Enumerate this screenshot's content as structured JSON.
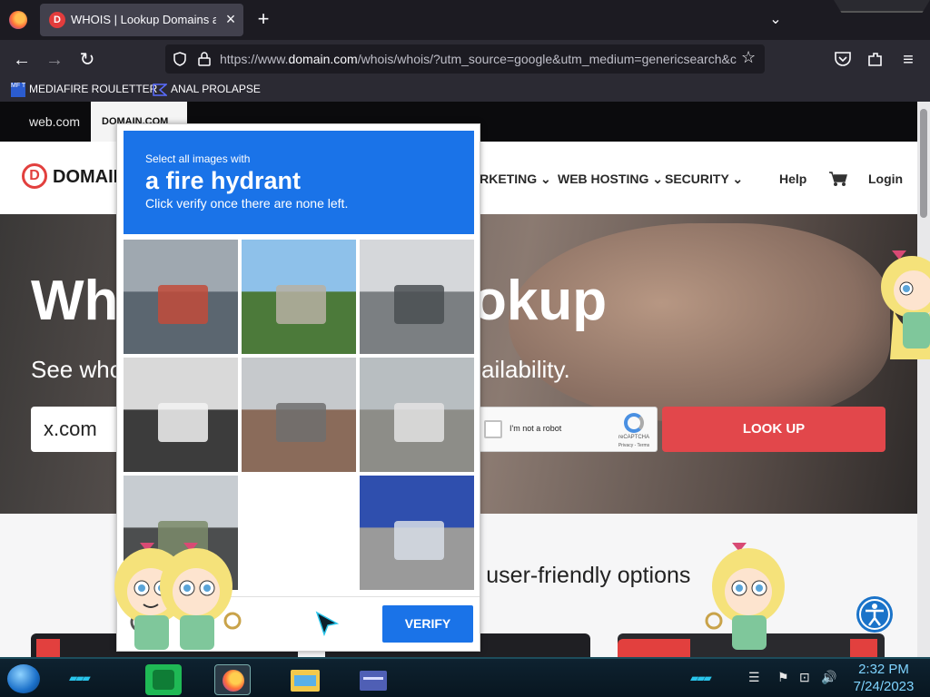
{
  "browser": {
    "tab_title": "WHOIS | Lookup Domains and",
    "tab_favicon": "D",
    "url_prefix": "https://www.",
    "url_domain": "domain.com",
    "url_rest": "/whois/whois/?utm_source=google&utm_medium=genericsearch&c",
    "bookmarks": [
      {
        "label": "MEDIAFIRE ROULETTER",
        "icon": "mediafire-icon"
      },
      {
        "label": "ANAL PROLAPSE",
        "icon": "bookmark-icon"
      }
    ]
  },
  "site": {
    "family_tabs": [
      "web.com",
      "DOMAIN.COM"
    ],
    "logo_text": "DOMAIN",
    "logo_mark": "D",
    "menu": [
      "ARKETING",
      "WEB HOSTING",
      "SECURITY"
    ],
    "help": "Help",
    "login": "Login",
    "hero_title_left": "Wh",
    "hero_title_right": "okup",
    "hero_sub_left": "See who",
    "hero_sub_right": "ailability.",
    "search_value": "x.com",
    "lookup_label": "LOOK UP",
    "options_text": "r user-friendly options",
    "recaptcha": {
      "label": "I'm not a robot",
      "brand": "reCAPTCHA",
      "links": "Privacy - Terms"
    }
  },
  "captcha": {
    "select_line": "Select all images with",
    "object": "a fire hydrant",
    "instruction": "Click verify once there are none left.",
    "verify_label": "VERIFY",
    "tiles": [
      {
        "desc": "street-bus-smoke",
        "colors": [
          "#9fa8b0",
          "#5b6670",
          "#c24b3a"
        ]
      },
      {
        "desc": "highway-bridge-trees",
        "colors": [
          "#8ec1ea",
          "#4c7a3a",
          "#b7b0a3"
        ]
      },
      {
        "desc": "power-lines-pole",
        "colors": [
          "#d5d7da",
          "#7b7f82",
          "#4a4f52"
        ]
      },
      {
        "desc": "stairs-car",
        "colors": [
          "#d9d9d9",
          "#3c3c3c",
          "#f2f2f2"
        ]
      },
      {
        "desc": "building-street",
        "colors": [
          "#c6c9cc",
          "#8a6b5a",
          "#6e6e6e"
        ]
      },
      {
        "desc": "graffiti-wall-bicycle",
        "colors": [
          "#b8bec1",
          "#8d8d88",
          "#e3e3e3"
        ]
      },
      {
        "desc": "traffic-light-pole",
        "colors": [
          "#c7ccd1",
          "#4c4e4f",
          "#7b8b6a"
        ]
      },
      {
        "desc": "blank",
        "colors": [
          "#ffffff",
          "#ffffff",
          "#ffffff"
        ]
      },
      {
        "desc": "blue-bus-street",
        "colors": [
          "#2f4fae",
          "#9a9a9a",
          "#d7dde6"
        ]
      }
    ]
  },
  "taskbar": {
    "time": "2:32 PM",
    "date": "7/24/2023",
    "apps": [
      "notes-app-icon",
      "firefox-icon",
      "file-explorer-icon",
      "window-app-icon"
    ]
  },
  "colors": {
    "captcha_blue": "#1a73e8",
    "lookup_red": "#e2474b",
    "brand_red": "#e2403e"
  }
}
